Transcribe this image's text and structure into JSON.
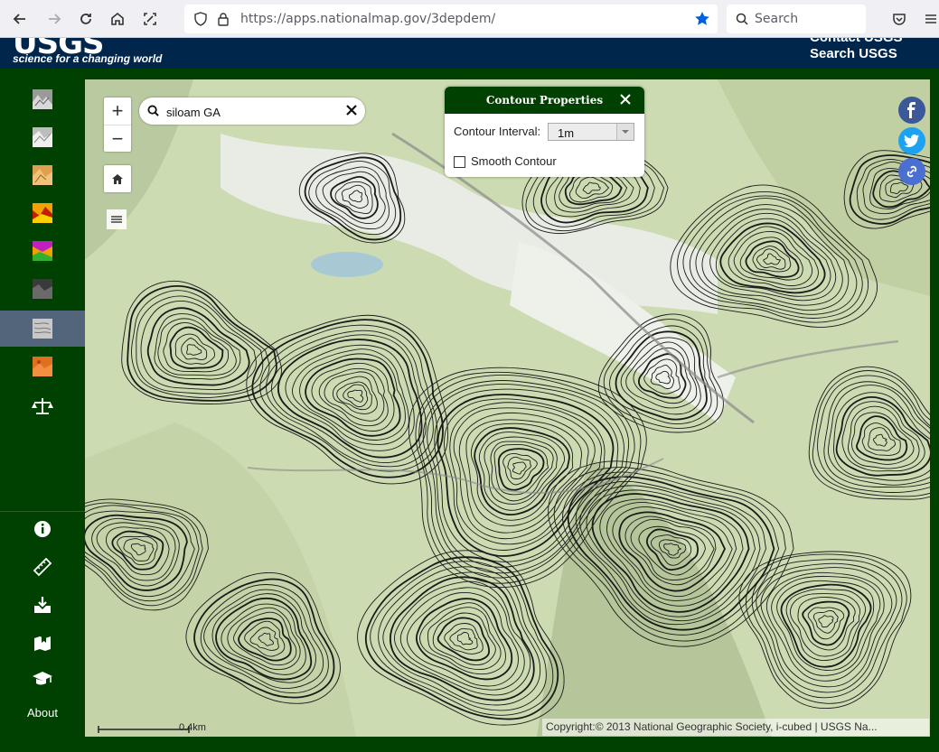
{
  "browser": {
    "url_host": "https://apps.nationalmap.gov",
    "url_path": "/3depdem/",
    "search_placeholder": "Search"
  },
  "header": {
    "logo_text": "USGS",
    "tagline": "science for a changing world",
    "links": [
      "Contact USGS",
      "Search USGS"
    ]
  },
  "sidebar": {
    "layers": [
      {
        "name": "hillshade-gray"
      },
      {
        "name": "hillshade-multidirectional"
      },
      {
        "name": "aspect-map"
      },
      {
        "name": "slope-map"
      },
      {
        "name": "tinted-hillshade"
      },
      {
        "name": "slope-degrees"
      },
      {
        "name": "contours",
        "active": true
      },
      {
        "name": "elevation-tinted"
      },
      {
        "name": "compare-scale"
      }
    ],
    "tools": [
      "info-icon",
      "measure-ruler-icon",
      "download-icon",
      "bookmark-icon",
      "education-icon"
    ],
    "about_label": "About"
  },
  "map": {
    "search_value": "siloam GA",
    "zoom_in": "+",
    "zoom_out": "−",
    "scale_label": "0.4km",
    "attribution": "Copyright:© 2013 National Geographic Society, i-cubed | USGS Na..."
  },
  "contour_panel": {
    "title": "Contour Properties",
    "interval_label": "Contour Interval:",
    "interval_value": "1m",
    "smooth_label": "Smooth Contour",
    "smooth_checked": false
  },
  "social": [
    {
      "name": "facebook",
      "color": "#3b5998",
      "glyph": "f"
    },
    {
      "name": "twitter",
      "color": "#1da1f2"
    },
    {
      "name": "share-link",
      "color": "#4a6fd0"
    }
  ],
  "colors": {
    "header_navy": "#00264c",
    "sidebar_green": "#004000",
    "active_item": "#53657a",
    "browser_star": "#0060df"
  }
}
